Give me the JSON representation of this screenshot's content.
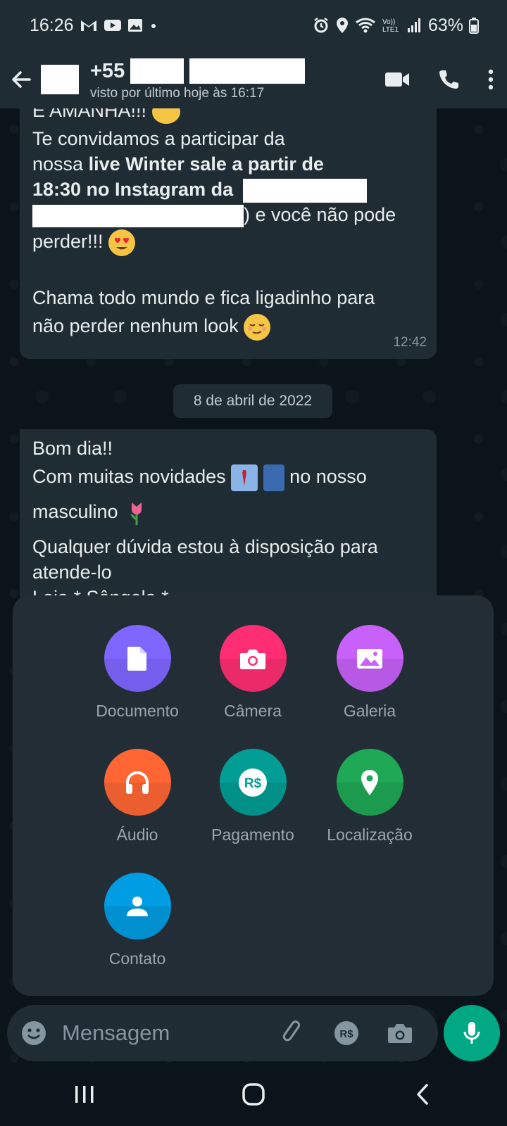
{
  "status_bar": {
    "time": "16:26",
    "notification_icons": [
      "gmail-icon",
      "youtube-icon",
      "gallery-icon",
      "dot-icon"
    ],
    "system_icons": [
      "alarm-icon",
      "location-icon",
      "wifi-icon",
      "volte-icon",
      "signal-icon"
    ],
    "volte_label": "Vo))\nLTE1",
    "battery": "63%"
  },
  "header": {
    "contact_prefix": "+55",
    "last_seen": "visto por último hoje às 16:17",
    "icons": [
      "back-arrow-icon",
      "video-call-icon",
      "voice-call-icon",
      "more-vert-icon"
    ]
  },
  "messages": [
    {
      "lines": [
        "E AMANHA!!!",
        "Te convidamos a participar da",
        "nossa ",
        "live Winter sale a partir de",
        "18:30 no Instagram da",
        ") e você não pode",
        "perder!!!",
        "Chama todo mundo e fica ligadinho para",
        "não perder nenhum look"
      ],
      "time": "12:42"
    },
    {
      "lines": [
        "Bom dia!!",
        "Com muitas novidades",
        " no nosso",
        "masculino",
        "Qualquer dúvida estou à disposição para",
        "atende-lo",
        "Loja * Sângela *"
      ]
    }
  ],
  "date_separator": "8 de abril de 2022",
  "attach_menu": [
    {
      "label": "Documento",
      "icon": "document-icon",
      "color": "#7f66ff"
    },
    {
      "label": "Câmera",
      "icon": "camera-icon",
      "color": "#ff2e74"
    },
    {
      "label": "Galeria",
      "icon": "gallery-icon",
      "color": "#c861fa"
    },
    {
      "label": "Áudio",
      "icon": "headphones-icon",
      "color": "#ff6633"
    },
    {
      "label": "Pagamento",
      "icon": "payment-icon",
      "color": "#029d94"
    },
    {
      "label": "Localização",
      "icon": "location-pin-icon",
      "color": "#1fa855"
    },
    {
      "label": "Contato",
      "icon": "contact-icon",
      "color": "#009de2"
    }
  ],
  "input": {
    "placeholder": "Mensagem",
    "payment_label": "R$"
  },
  "colors": {
    "accent": "#00a884",
    "bubble": "#202c33",
    "background": "#0b141a",
    "header": "#1f2c34"
  }
}
